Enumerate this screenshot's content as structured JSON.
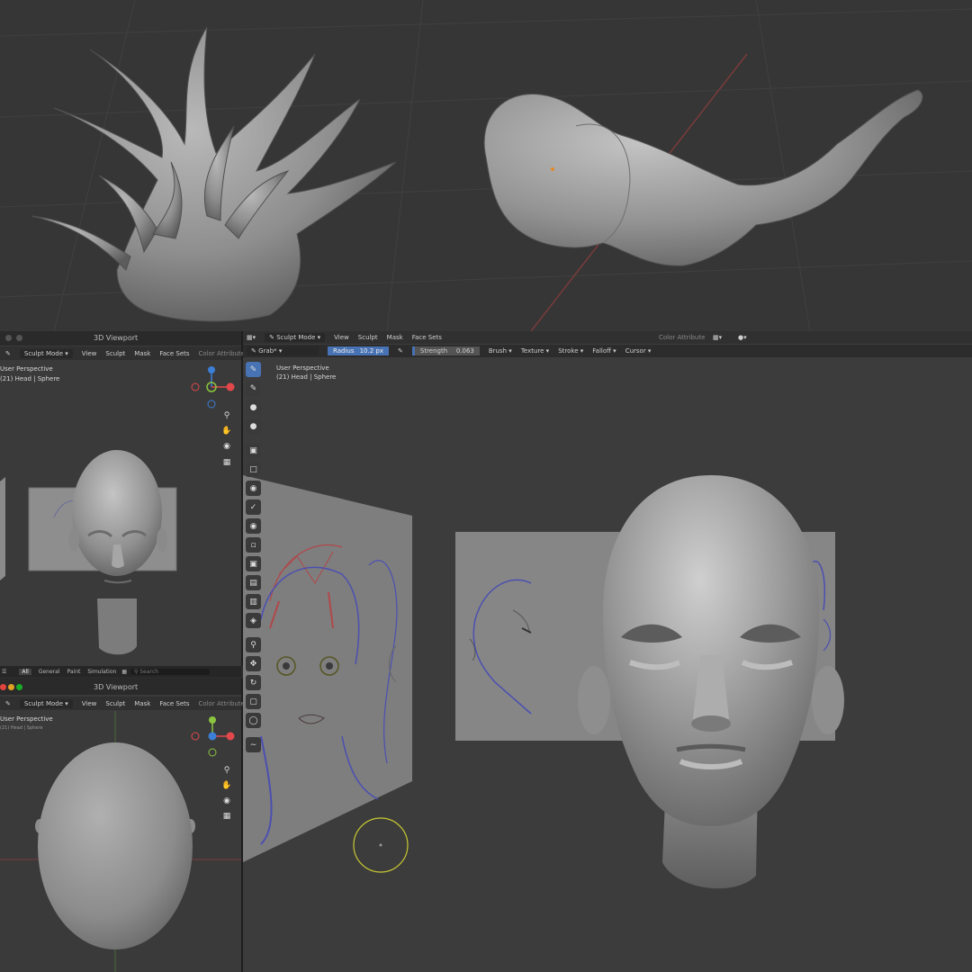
{
  "panels": {
    "top_left_viewport": {
      "title": "3D Viewport",
      "mode": "Sculpt Mode",
      "menus": [
        "View",
        "Sculpt",
        "Mask",
        "Face Sets"
      ],
      "right_label": "Color Attribute",
      "overlay_line1": "User Perspective",
      "overlay_line2": "(21) Head | Sphere"
    },
    "bottom_left_viewport": {
      "title": "3D Viewport",
      "mode": "Sculpt Mode",
      "menus": [
        "View",
        "Sculpt",
        "Mask",
        "Face Sets"
      ],
      "right_label": "Color Attribute",
      "overlay_line1": "User Perspective",
      "overlay_line2": "(21) Head | Sphere"
    },
    "asset_bar": {
      "filters": [
        "All",
        "General",
        "Paint",
        "Simulation"
      ],
      "search_placeholder": "Search"
    },
    "main_viewport": {
      "mode": "Sculpt Mode",
      "menus": [
        "View",
        "Sculpt",
        "Mask",
        "Face Sets"
      ],
      "right_label": "Color Attribute",
      "brush": "Grab",
      "radius_label": "Radius",
      "radius_value": "10.2 px",
      "strength_label": "Strength",
      "strength_value": "0.063",
      "tool_menus": [
        "Brush",
        "Texture",
        "Stroke",
        "Falloff",
        "Cursor"
      ],
      "overlay_line1": "User Perspective",
      "overlay_line2": "(21) Head | Sphere"
    }
  },
  "icons": {
    "nav": [
      "zoom-icon",
      "hand-icon",
      "camera-icon",
      "grid-icon"
    ],
    "tools": [
      "draw-icon",
      "draw-sharp-icon",
      "clay-icon",
      "clay-strips-icon",
      "layer-icon",
      "inflate-icon",
      "blob-icon",
      "crease-icon",
      "smooth-icon",
      "flatten-icon",
      "fill-icon",
      "scrape-icon",
      "multiplane-icon",
      "pinch-icon",
      "grab-icon",
      "move-icon",
      "rotate-icon",
      "scale-icon",
      "transform-icon",
      "annotate-icon"
    ]
  },
  "colors": {
    "background": "#2b2b2b",
    "header": "#303030",
    "active_tool": "#4772b3",
    "axis_x": "#e2474c",
    "axis_y": "#8bc43f",
    "axis_z": "#3b7fd6",
    "sculpt_gray": "#8c8c8c",
    "brush_cursor": "#c8c832"
  }
}
